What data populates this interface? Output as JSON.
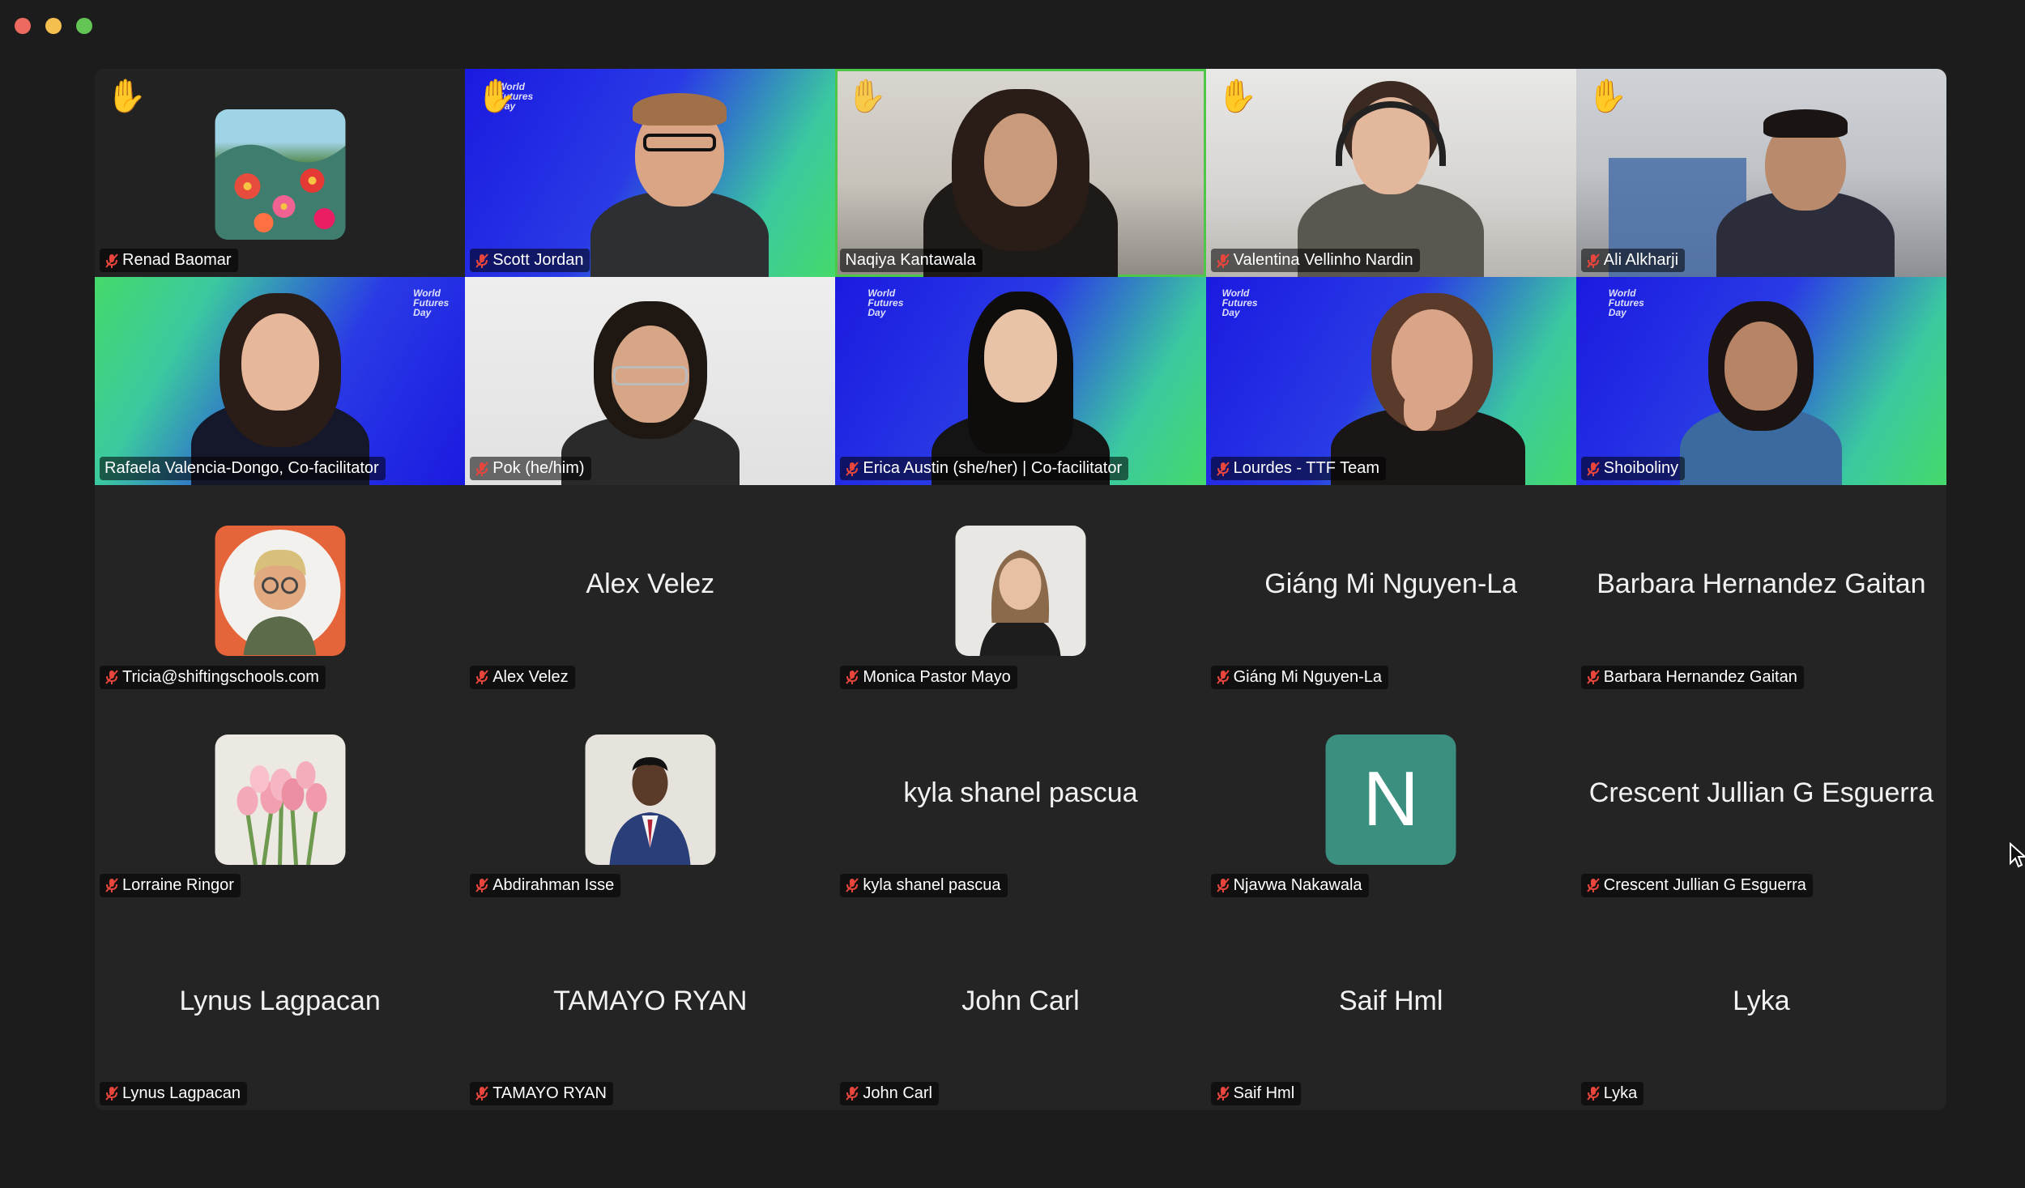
{
  "window": {
    "traffic_lights": [
      "close",
      "minimize",
      "zoom"
    ]
  },
  "colors": {
    "background": "#1c1c1c",
    "tile": "#242424",
    "active_speaker_border": "#4ec64a",
    "muted_mic": "#e8453c",
    "avatar_letter_bg": "#3a8f7e"
  },
  "participants": [
    {
      "name": "Renad Baomar",
      "hand_raised": true,
      "muted": true,
      "display": "avatar",
      "avatar": "flower-painting"
    },
    {
      "name": "Scott Jordan",
      "hand_raised": true,
      "muted": true,
      "display": "video"
    },
    {
      "name": "Naqiya Kantawala",
      "hand_raised": true,
      "muted": false,
      "display": "video",
      "active_speaker": true
    },
    {
      "name": "Valentina Vellinho Nardin",
      "hand_raised": true,
      "muted": true,
      "display": "video"
    },
    {
      "name": "Ali Alkharji",
      "hand_raised": true,
      "muted": true,
      "display": "video"
    },
    {
      "name": "Rafaela Valencia-Dongo, Co-facilitator",
      "muted": false,
      "display": "video"
    },
    {
      "name": "Pok (he/him)",
      "muted": true,
      "display": "video"
    },
    {
      "name": "Erica Austin (she/her) | Co-facilitator",
      "muted": true,
      "display": "video"
    },
    {
      "name": "Lourdes - TTF Team",
      "muted": true,
      "display": "video"
    },
    {
      "name": "Shoiboliny",
      "muted": true,
      "display": "video"
    },
    {
      "name": "Tricia@shiftingschools.com",
      "muted": true,
      "display": "avatar",
      "avatar": "cartoon-person"
    },
    {
      "name": "Alex Velez",
      "muted": true,
      "display": "name"
    },
    {
      "name": "Monica Pastor Mayo",
      "muted": true,
      "display": "avatar",
      "avatar": "photo-portrait"
    },
    {
      "name": "Giáng Mi Nguyen-La",
      "muted": true,
      "display": "name"
    },
    {
      "name": "Barbara Hernandez Gaitan",
      "muted": true,
      "display": "name"
    },
    {
      "name": "Lorraine Ringor",
      "muted": true,
      "display": "avatar",
      "avatar": "tulips"
    },
    {
      "name": "Abdirahman Isse",
      "muted": true,
      "display": "avatar",
      "avatar": "photo-suit"
    },
    {
      "name": "kyla shanel pascua",
      "muted": true,
      "display": "name"
    },
    {
      "name": "Njavwa Nakawala",
      "muted": true,
      "display": "avatar",
      "avatar": "letter",
      "letter": "N"
    },
    {
      "name": "Crescent Jullian G Esguerra",
      "muted": true,
      "display": "name"
    },
    {
      "name": "Lynus Lagpacan",
      "muted": true,
      "display": "name"
    },
    {
      "name": "TAMAYO RYAN",
      "muted": true,
      "display": "name"
    },
    {
      "name": "John Carl",
      "muted": true,
      "display": "name"
    },
    {
      "name": "Saif Hml",
      "muted": true,
      "display": "name"
    },
    {
      "name": "Lyka",
      "muted": true,
      "display": "name"
    }
  ],
  "branding": {
    "event_logo": "World Futures Day"
  }
}
